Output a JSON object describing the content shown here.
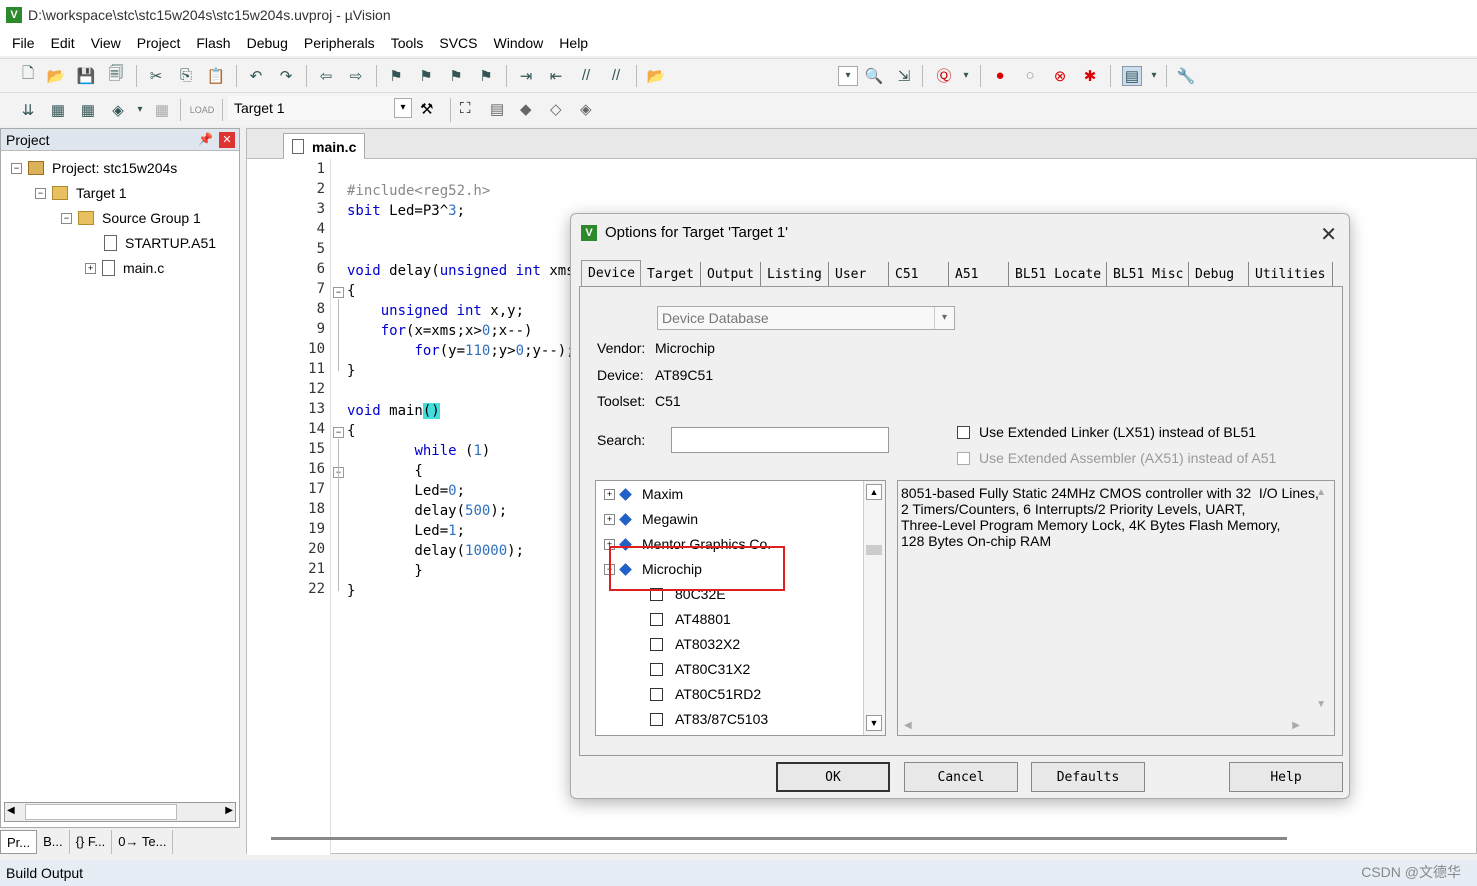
{
  "window": {
    "title": "D:\\workspace\\stc\\stc15w204s\\stc15w204s.uvproj - µVision",
    "icon_text": "V"
  },
  "menu": [
    "File",
    "Edit",
    "View",
    "Project",
    "Flash",
    "Debug",
    "Peripherals",
    "Tools",
    "SVCS",
    "Window",
    "Help"
  ],
  "toolbar": {
    "target_name": "Target 1"
  },
  "project_panel": {
    "title": "Project",
    "tree": [
      {
        "label": "Project: stc15w204s",
        "level": 0,
        "icon": "project-icon",
        "expander": "⊟"
      },
      {
        "label": "Target 1",
        "level": 1,
        "icon": "target-folder-icon",
        "expander": "⊟"
      },
      {
        "label": "Source Group 1",
        "level": 2,
        "icon": "folder-icon",
        "expander": "⊟"
      },
      {
        "label": "STARTUP.A51",
        "level": 3,
        "icon": "file-icon",
        "expander": ""
      },
      {
        "label": "main.c",
        "level": 3,
        "icon": "file-icon",
        "expander": "⊞"
      }
    ],
    "bottom_tabs": [
      "Pr...",
      "B...",
      "{} F...",
      "0→ Te..."
    ]
  },
  "editor": {
    "tab": "main.c",
    "line_numbers": [
      "1",
      "2",
      "3",
      "4",
      "5",
      "6",
      "7",
      "8",
      "9",
      "10",
      "11",
      "12",
      "13",
      "14",
      "15",
      "16",
      "17",
      "18",
      "19",
      "20",
      "21",
      "22"
    ]
  },
  "dialog": {
    "title": "Options for Target 'Target 1'",
    "tabs": [
      "Device",
      "Target",
      "Output",
      "Listing",
      "User",
      "C51",
      "A51",
      "BL51 Locate",
      "BL51 Misc",
      "Debug",
      "Utilities"
    ],
    "database": "Device Database",
    "vendor_label": "Vendor:",
    "vendor": "Microchip",
    "device_label": "Device:",
    "device": "AT89C51",
    "toolset_label": "Toolset:",
    "toolset": "C51",
    "search_label": "Search:",
    "search_value": "",
    "use_lx51": "Use Extended Linker (LX51) instead of BL51",
    "use_ax51": "Use Extended Assembler (AX51) instead of A51",
    "device_tree": [
      {
        "label": "Maxim",
        "kind": "vendor"
      },
      {
        "label": "Megawin",
        "kind": "vendor"
      },
      {
        "label": "Mentor Graphics Co.",
        "kind": "vendor"
      },
      {
        "label": "Microchip",
        "kind": "vendor"
      },
      {
        "label": "80C32E",
        "kind": "device"
      },
      {
        "label": "AT48801",
        "kind": "device"
      },
      {
        "label": "AT8032X2",
        "kind": "device"
      },
      {
        "label": "AT80C31X2",
        "kind": "device"
      },
      {
        "label": "AT80C51RD2",
        "kind": "device"
      },
      {
        "label": "AT83/87C5103",
        "kind": "device"
      }
    ],
    "description": "8051-based Fully Static 24MHz CMOS controller with 32  I/O Lines,\n2 Timers/Counters, 6 Interrupts/2 Priority Levels, UART,\nThree-Level Program Memory Lock, 4K Bytes Flash Memory,\n128 Bytes On-chip RAM",
    "buttons": {
      "ok": "OK",
      "cancel": "Cancel",
      "defaults": "Defaults",
      "help": "Help"
    }
  },
  "status": {
    "build_output": "Build Output",
    "watermark": "CSDN @文德华"
  }
}
